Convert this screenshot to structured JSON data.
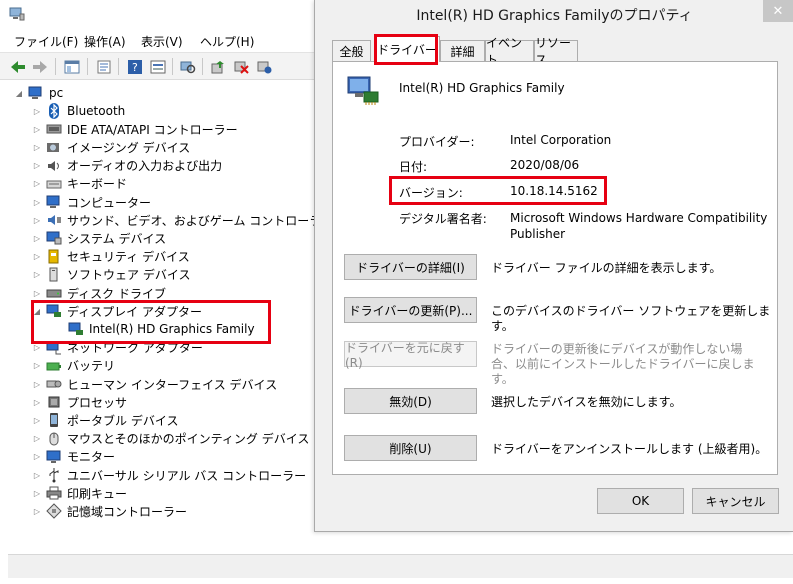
{
  "device_manager": {
    "menu": [
      "ファイル(F)",
      "操作(A)",
      "表示(V)",
      "ヘルプ(H)"
    ],
    "tree": {
      "root": "pc",
      "items": [
        {
          "label": "Bluetooth",
          "icon": "bluetooth-icon"
        },
        {
          "label": "IDE ATA/ATAPI コントローラー",
          "icon": "ide-controller-icon"
        },
        {
          "label": "イメージング デバイス",
          "icon": "camera-icon"
        },
        {
          "label": "オーディオの入力および出力",
          "icon": "speaker-icon"
        },
        {
          "label": "キーボード",
          "icon": "keyboard-icon"
        },
        {
          "label": "コンピューター",
          "icon": "computer-icon"
        },
        {
          "label": "サウンド、ビデオ、およびゲーム コントローラー",
          "icon": "sound-icon"
        },
        {
          "label": "システム デバイス",
          "icon": "system-device-icon"
        },
        {
          "label": "セキュリティ デバイス",
          "icon": "security-key-icon"
        },
        {
          "label": "ソフトウェア デバイス",
          "icon": "software-device-icon"
        },
        {
          "label": "ディスク ドライブ",
          "icon": "disk-drive-icon"
        },
        {
          "label": "ディスプレイ アダプター",
          "icon": "display-adapter-icon"
        },
        {
          "label": "Intel(R) HD Graphics Family",
          "icon": "display-adapter-icon"
        },
        {
          "label": "ネットワーク アダプター",
          "icon": "network-adapter-icon"
        },
        {
          "label": "バッテリ",
          "icon": "battery-icon"
        },
        {
          "label": "ヒューマン インターフェイス デバイス",
          "icon": "hid-icon"
        },
        {
          "label": "プロセッサ",
          "icon": "processor-icon"
        },
        {
          "label": "ポータブル デバイス",
          "icon": "portable-device-icon"
        },
        {
          "label": "マウスとそのほかのポインティング デバイス",
          "icon": "mouse-icon"
        },
        {
          "label": "モニター",
          "icon": "monitor-icon"
        },
        {
          "label": "ユニバーサル シリアル バス コントローラー",
          "icon": "usb-icon"
        },
        {
          "label": "印刷キュー",
          "icon": "printer-icon"
        },
        {
          "label": "記憶域コントローラー",
          "icon": "storage-controller-icon"
        }
      ]
    }
  },
  "dialog": {
    "title": "Intel(R) HD Graphics Familyのプロパティ",
    "close": "✕",
    "tabs": [
      "全般",
      "ドライバー",
      "詳細",
      "イベント",
      "リソース"
    ],
    "active_tab": "ドライバー",
    "device_name": "Intel(R) HD Graphics Family",
    "properties": [
      {
        "label": "プロバイダー:",
        "value": "Intel Corporation"
      },
      {
        "label": "日付:",
        "value": "2020/08/06"
      },
      {
        "label": "バージョン:",
        "value": "10.18.14.5162"
      },
      {
        "label": "デジタル署名者:",
        "value": "Microsoft Windows Hardware Compatibility Publisher"
      }
    ],
    "actions": [
      {
        "button": "ドライバーの詳細(I)",
        "desc": "ドライバー ファイルの詳細を表示します。",
        "enabled": true
      },
      {
        "button": "ドライバーの更新(P)...",
        "desc": "このデバイスのドライバー ソフトウェアを更新します。",
        "enabled": true
      },
      {
        "button": "ドライバーを元に戻す(R)",
        "desc": "ドライバーの更新後にデバイスが動作しない場合、以前にインストールしたドライバーに戻します。",
        "enabled": false
      },
      {
        "button": "無効(D)",
        "desc": "選択したデバイスを無効にします。",
        "enabled": true
      },
      {
        "button": "削除(U)",
        "desc": "ドライバーをアンインストールします (上級者用)。",
        "enabled": true
      }
    ],
    "ok": "OK",
    "cancel": "キャンセル"
  },
  "colors": {
    "highlight": "#e60012",
    "selection": "#cce8ff"
  }
}
